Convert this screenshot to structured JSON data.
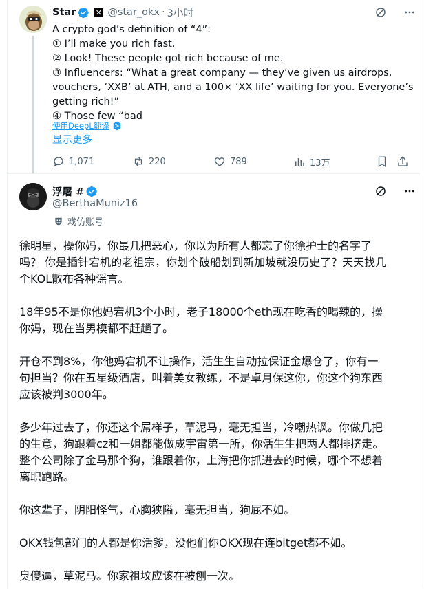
{
  "tweet1": {
    "display_name": "Star",
    "handle": "@star_okx",
    "separator": "·",
    "time": "3小时",
    "lines": [
      "A crypto god’s definition of “4”:",
      "① I’ll make you rich fast.",
      "② Look! These people got rich because of me.",
      "③ Influencers: “What a great company — they’ve given us airdrops,",
      "vouchers, ‘XXB’ at ATH, and a 100× ‘XX life’ waiting for you. Everyone’s",
      "getting rich!”",
      "④ Those few “bad"
    ],
    "translate_label": "使用DeepL翻译",
    "show_more": "显示更多",
    "replies": "1,071",
    "reposts": "220",
    "likes": "789",
    "views": "13万"
  },
  "tweet2": {
    "display_name": "浮屠 #",
    "handle": "@BerthaMuniz16",
    "parody_label": "戏仿账号",
    "paragraphs": [
      [
        "徐明星，操你妈，你最几把恶心，你以为所有人都忘了你徐护士的名字了",
        "吗？ 你是插针宕机的老祖宗，你划个破船划到新加坡就没历史了？天天找几",
        "个KOL散布各种谣言。"
      ],
      [
        "18年95不是你他妈宕机3个小时，老子18000个eth现在吃香的喝辣的，操",
        "你妈，现在当男模都不赶趟了。"
      ],
      [
        "开仓不到8%，你他妈宕机不让操作，活生生自动拉保证金爆仓了，你有一",
        "句担当？你在五星级酒店，叫着美女教练，不是卓月保这你，你这个狗东西",
        "应该被判3000年。"
      ],
      [
        "多少年过去了，你还这个屌样子，草泥马，毫无担当，冷嘲热讽。你做几把",
        "的生意，狗跟着cz和一姐都能做成宇宙第一所，你活生生把两人都排挤走。",
        "整个公司除了金马那个狗，谁跟着你，上海把你抓进去的时候，哪个不想着",
        "离职跑路。"
      ],
      [
        "你这辈子，阴阳怪气，心胸狭隘，毫无担当，狗屁不如。"
      ],
      [
        "OKX钱包部门的人都是你活爹，没他们你OKX现在连bitget都不如。"
      ],
      [
        "臭傻逼，草泥马。你家祖坟应该在被刨一次。"
      ]
    ]
  },
  "colors": {
    "accent": "#1d9bf0",
    "muted": "#536471",
    "text": "#0f1419",
    "verified": "#1d9bf0"
  }
}
